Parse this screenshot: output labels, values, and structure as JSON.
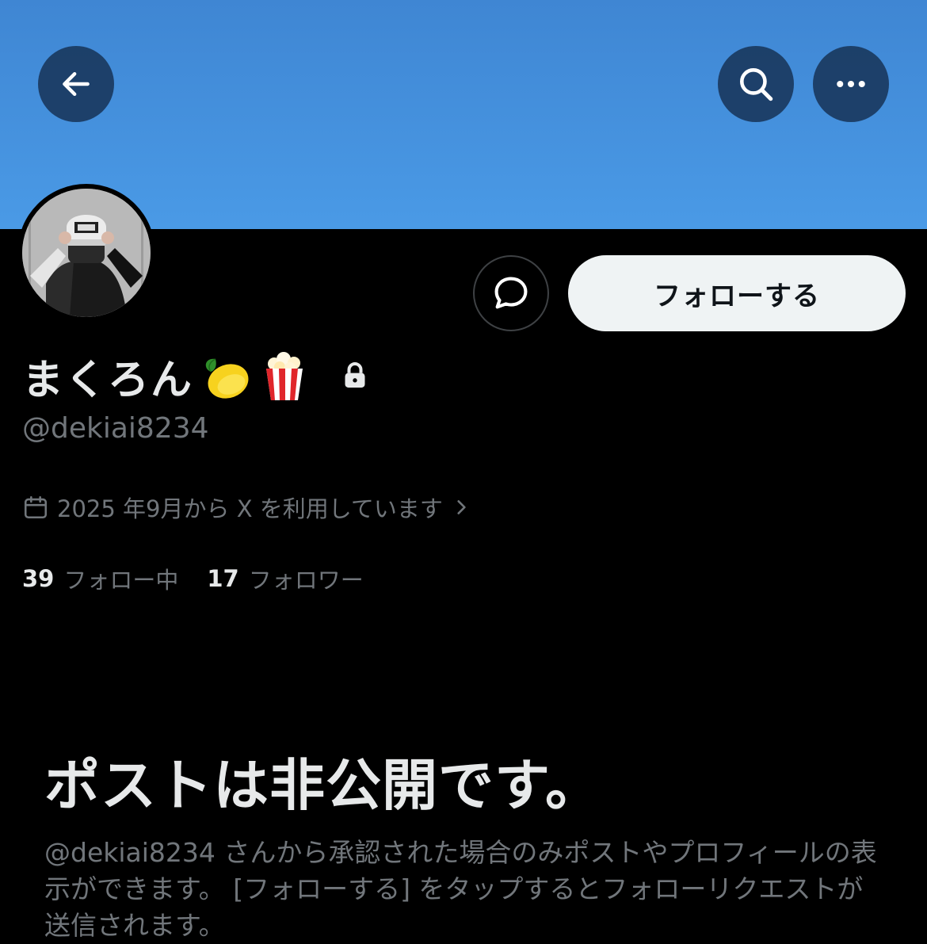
{
  "profile": {
    "display_name": "まくろん",
    "handle": "@dekiai8234",
    "joined": "2025 年9月から X を利用しています"
  },
  "actions": {
    "follow_label": "フォローする"
  },
  "stats": {
    "following_count": "39",
    "following_label": "フォロー中",
    "followers_count": "17",
    "followers_label": "フォロワー"
  },
  "private_notice": {
    "title": "ポストは非公開です。",
    "description": "@dekiai8234 さんから承認された場合のみポストやプロフィールの表示ができます。 [フォローする] をタップするとフォローリクエストが送信されます。"
  },
  "colors": {
    "banner": "#4a9ae6",
    "background": "#000000",
    "text_primary": "#e7e9ea",
    "text_secondary": "#71767b",
    "follow_button_bg": "#eff3f4"
  },
  "icons": {
    "back": "arrow-left-icon",
    "search": "search-icon",
    "more": "more-horizontal-icon",
    "message": "message-bubble-icon",
    "lemon": "lemon-emoji-icon",
    "popcorn": "popcorn-emoji-icon",
    "lock": "lock-icon",
    "calendar": "calendar-icon",
    "chevron": "chevron-right-icon"
  }
}
